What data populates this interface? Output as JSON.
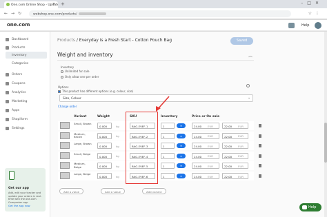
{
  "browser": {
    "tab_title": "One.com Online Shop - Update",
    "url": "webshop.one.com/products/"
  },
  "app": {
    "logo": "one.com",
    "help_label": "Help"
  },
  "sidebar": {
    "items": [
      {
        "label": "Dashboard"
      },
      {
        "label": "Products"
      },
      {
        "label": "Inventory"
      },
      {
        "label": "Categories"
      },
      {
        "label": "Orders"
      },
      {
        "label": "Coupons"
      },
      {
        "label": "Analytics"
      },
      {
        "label": "Marketing"
      },
      {
        "label": "Apps"
      },
      {
        "label": "Shopiform"
      },
      {
        "label": "Settings"
      }
    ],
    "promo": {
      "title": "Get our app",
      "text": "Add, edit your tracker and update your orders in real-time with the one.com Companion app",
      "link": "Get the app now"
    }
  },
  "page": {
    "breadcrumb_parent": "Products",
    "breadcrumb_current": "/ Everyday is a Fresh Start - Cotton Pouch Bag",
    "saved_label": "Saved",
    "section_title": "Weight and inventory",
    "inventory_label": "Inventory",
    "radio_unlimited": "Unlimited for sale",
    "radio_once": "Only allow one per order",
    "options_check": "This product has different options (e.g. colour, size)",
    "options_label": "Options",
    "options_value": "Size, Colour",
    "change_order": "Change order"
  },
  "table": {
    "headers": {
      "variant": "Variant",
      "weight": "Weight",
      "sku": "SKU",
      "inventory": "Inventory",
      "price": "Price or On sale"
    },
    "weight_unit": "kg",
    "currency": "EUR",
    "rows": [
      {
        "variant": "Small, Brown",
        "weight": "0.000",
        "sku": "BAG-EVEF-1",
        "inventory": "1",
        "price": "24.00",
        "sale": "22.00"
      },
      {
        "variant": "Medium, Brown",
        "weight": "0.000",
        "sku": "BAG-EVEF-2",
        "inventory": "1",
        "price": "24.00",
        "sale": "22.00"
      },
      {
        "variant": "Large, Brown",
        "weight": "0.000",
        "sku": "BAG-EVEF-3",
        "inventory": "1",
        "price": "24.00",
        "sale": "22.00"
      },
      {
        "variant": "Small, Beige",
        "weight": "0.000",
        "sku": "BAG-EVEF-4",
        "inventory": "1",
        "price": "24.00",
        "sale": "22.00"
      },
      {
        "variant": "Medium, Beige",
        "weight": "0.000",
        "sku": "BAG-EVEF-5",
        "inventory": "1",
        "price": "24.00",
        "sale": "22.00"
      },
      {
        "variant": "Large, Beige",
        "weight": "0.000",
        "sku": "BAG-EVEF-6",
        "inventory": "1",
        "price": "24.00",
        "sale": "22.00"
      }
    ],
    "add_value": "Add a value",
    "add_value_2": "Add a value",
    "add_variant": "Add variant"
  },
  "fab": {
    "label": "Help"
  },
  "colors": {
    "accent": "#1a73e8",
    "highlight": "#e53935",
    "help_green": "#2e7d32"
  }
}
